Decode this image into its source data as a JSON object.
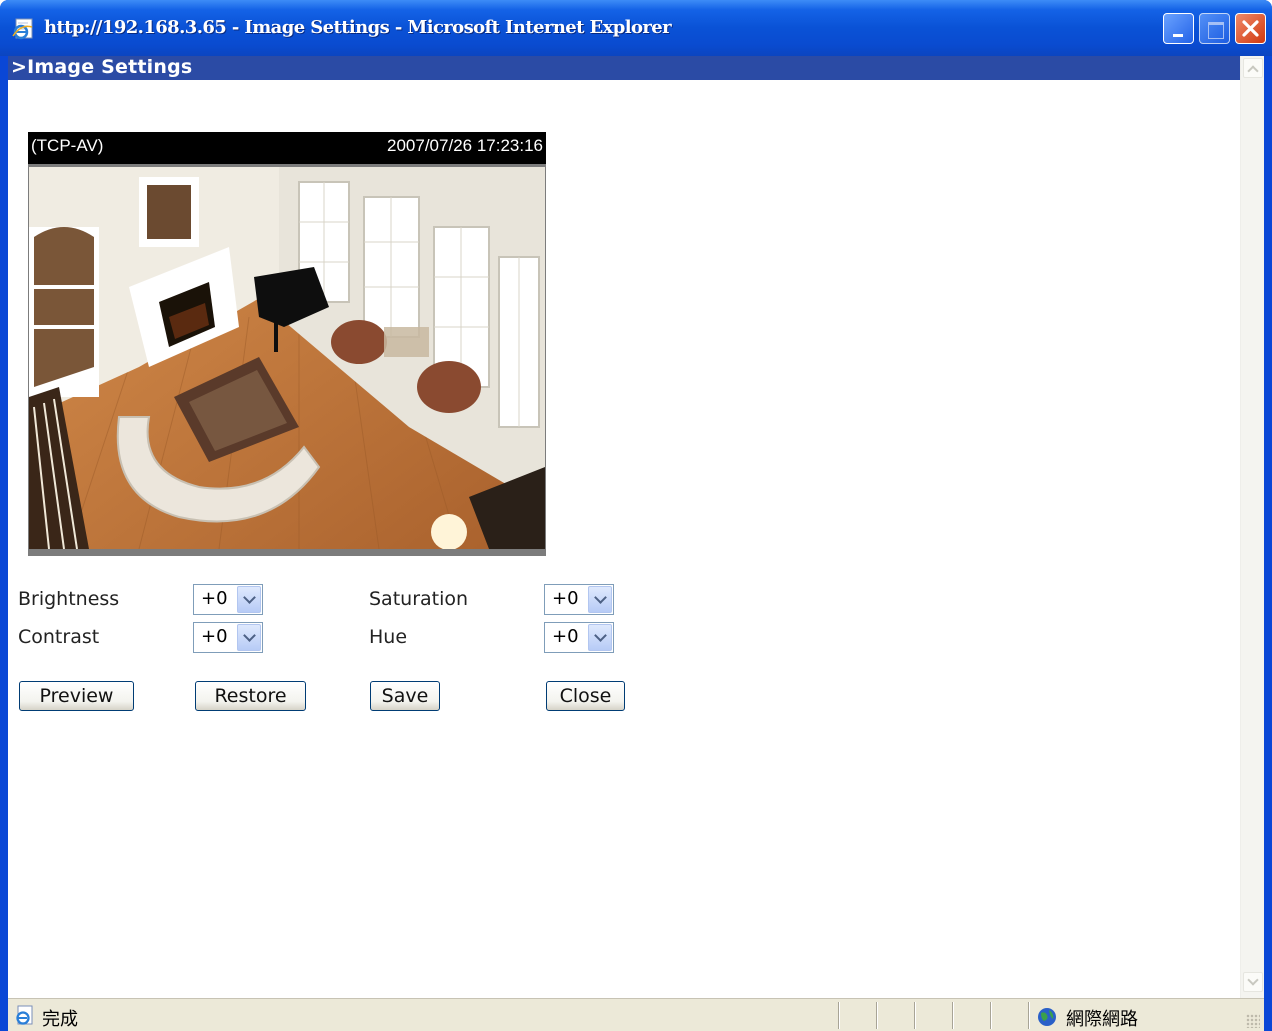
{
  "window": {
    "title": "http://192.168.3.65 - Image Settings - Microsoft Internet Explorer",
    "icon": "ie-page-icon",
    "controls": [
      "minimize-icon",
      "maximize-icon",
      "close-icon"
    ]
  },
  "page": {
    "header": ">Image Settings"
  },
  "video": {
    "label": "(TCP-AV)",
    "timestamp": "2007/07/26 17:23:16"
  },
  "settings": {
    "brightness": {
      "label": "Brightness",
      "value": "+0"
    },
    "contrast": {
      "label": "Contrast",
      "value": "+0"
    },
    "saturation": {
      "label": "Saturation",
      "value": "+0"
    },
    "hue": {
      "label": "Hue",
      "value": "+0"
    }
  },
  "buttons": {
    "preview": "Preview",
    "restore": "Restore",
    "save": "Save",
    "close": "Close"
  },
  "status": {
    "text": "完成",
    "zone": "網際網路"
  },
  "colors": {
    "titlebar": "#0a52d6",
    "header": "#2b4ba5",
    "close_button": "#d0380e"
  }
}
